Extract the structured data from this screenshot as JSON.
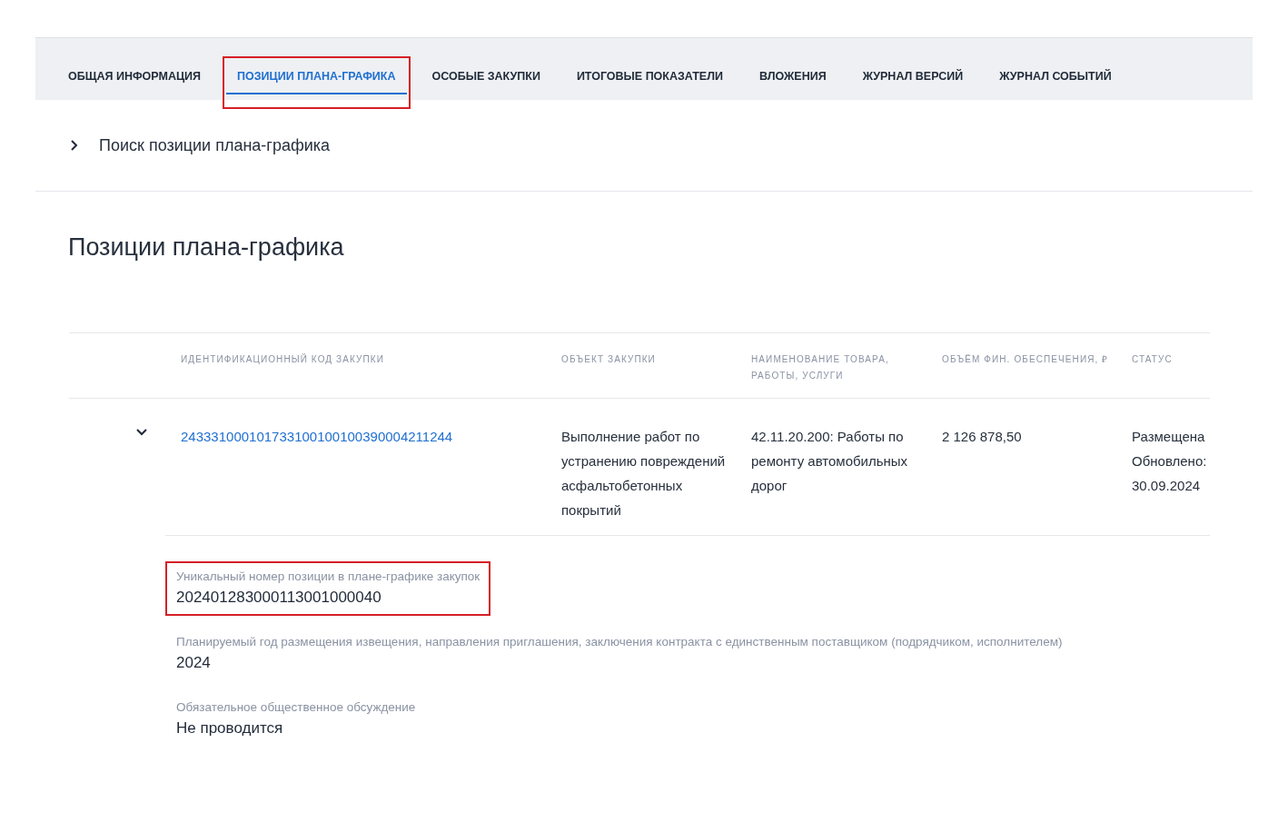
{
  "tabs": [
    {
      "label": "ОБЩАЯ ИНФОРМАЦИЯ",
      "selected": false,
      "highlighted": false
    },
    {
      "label": "ПОЗИЦИИ ПЛАНА-ГРАФИКА",
      "selected": true,
      "highlighted": true
    },
    {
      "label": "ОСОБЫЕ ЗАКУПКИ",
      "selected": false,
      "highlighted": false
    },
    {
      "label": "ИТОГОВЫЕ ПОКАЗАТЕЛИ",
      "selected": false,
      "highlighted": false
    },
    {
      "label": "ВЛОЖЕНИЯ",
      "selected": false,
      "highlighted": false
    },
    {
      "label": "ЖУРНАЛ ВЕРСИЙ",
      "selected": false,
      "highlighted": false
    },
    {
      "label": "ЖУРНАЛ СОБЫТИЙ",
      "selected": false,
      "highlighted": false
    }
  ],
  "search": {
    "label": "Поиск позиции плана-графика",
    "expanded": false
  },
  "heading": "Позиции плана-графика",
  "table": {
    "columns": [
      "ИДЕНТИФИКАЦИОННЫЙ КОД ЗАКУПКИ",
      "ОБЪЕКТ ЗАКУПКИ",
      "НАИМЕНОВАНИЕ ТОВАРА, РАБОТЫ, УСЛУГИ",
      "ОБЪЁМ ФИН. ОБЕСПЕЧЕНИЯ, ₽",
      "СТАТУС"
    ],
    "rows": [
      {
        "expanded": true,
        "code": "243331000101733100100100390004211244",
        "object": "Выполнение работ по устранению повреждений асфальтобетонных покрытий",
        "name": "42.11.20.200: Работы по ремонту автомобильных дорог",
        "amount": "2 126 878,50",
        "status": [
          "Размещена",
          "Обновлено:",
          "30.09.2024"
        ],
        "details": [
          {
            "label": "Уникальный номер позиции в плане-графике закупок",
            "value": "202401283000113001000040",
            "highlighted": true
          },
          {
            "label": "Планируемый год размещения извещения, направления приглашения, заключения контракта с единственным поставщиком (подрядчиком, исполнителем)",
            "value": "2024",
            "highlighted": false
          },
          {
            "label": "Обязательное общественное обсуждение",
            "value": "Не проводится",
            "highlighted": false
          }
        ]
      }
    ]
  }
}
